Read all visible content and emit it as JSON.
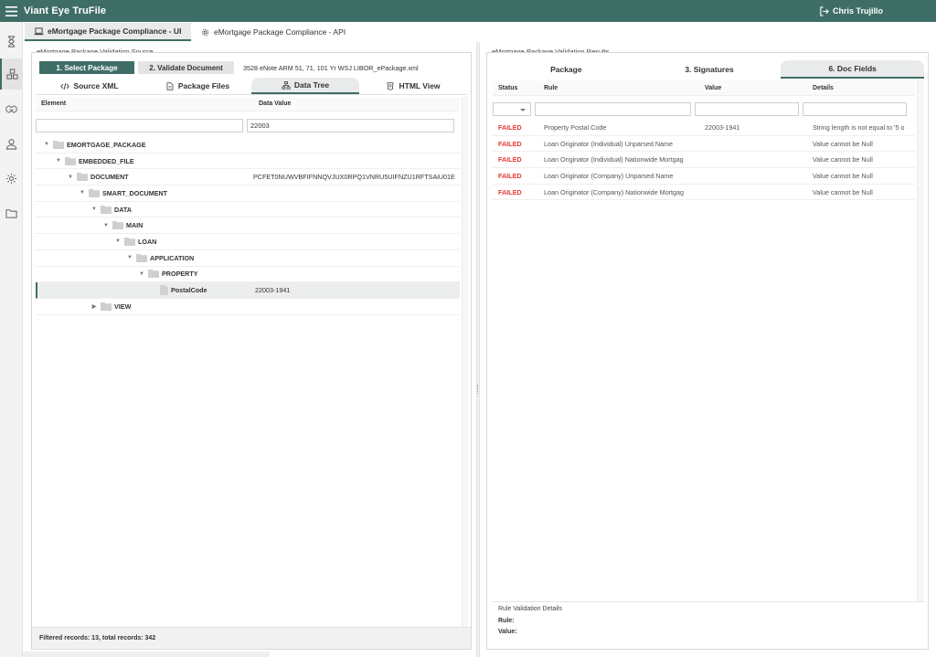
{
  "header": {
    "app_title": "Viant Eye TruFile",
    "user_name": "Chris Trujillo"
  },
  "leftrail": {
    "icons": [
      "hourglass-icon",
      "packages-icon",
      "handshake-icon",
      "user-icon",
      "gear-icon",
      "folder-icon"
    ]
  },
  "main_tabs": [
    {
      "label": "eMortgage Package Compliance - UI",
      "active": true
    },
    {
      "label": "eMortgage Package Compliance - API",
      "active": false
    }
  ],
  "source": {
    "legend": "eMortgage Package Validation Source",
    "step1": "1. Select Package",
    "step2": "2. Validate Document",
    "file_name": "3528 eNote ARM 51, 71, 101 Yr WSJ LIBOR_ePackage.xml",
    "tabs": [
      "Source XML",
      "Package Files",
      "Data Tree",
      "HTML View"
    ],
    "active_tab": "Data Tree",
    "columns": {
      "element": "Element",
      "value": "Data Value"
    },
    "filter": {
      "element": "",
      "value": "22003"
    },
    "tree": [
      {
        "name": "EMORTGAGE_PACKAGE",
        "value": ""
      },
      {
        "name": "EMBEDDED_FILE",
        "value": ""
      },
      {
        "name": "DOCUMENT",
        "value": "PCFET0NUWVBFIFNNQVJUX0RPQ1VNRU5UIFNZU1RFTSAiU01E"
      },
      {
        "name": "SMART_DOCUMENT",
        "value": ""
      },
      {
        "name": "DATA",
        "value": ""
      },
      {
        "name": "MAIN",
        "value": ""
      },
      {
        "name": "LOAN",
        "value": ""
      },
      {
        "name": "APPLICATION",
        "value": ""
      },
      {
        "name": "PROPERTY",
        "value": ""
      },
      {
        "name": "PostalCode",
        "value": "22003-1941"
      },
      {
        "name": "VIEW",
        "value": ""
      }
    ],
    "status": "Filtered records: 13, total records: 342"
  },
  "results": {
    "legend": "eMortgage Package Validation Results",
    "tabs": [
      "Package",
      "3. Signatures",
      "6. Doc Fields"
    ],
    "active_tab": "6. Doc Fields",
    "columns": {
      "status": "Status",
      "rule": "Rule",
      "value": "Value",
      "details": "Details"
    },
    "rows": [
      {
        "status": "FAILED",
        "rule": "Property Postal Code",
        "value": "22003-1941",
        "details": "String length is not equal to '5 o"
      },
      {
        "status": "FAILED",
        "rule": "Loan Originator (Individual) Unparsed Name",
        "value": "",
        "details": "Value cannot be Null"
      },
      {
        "status": "FAILED",
        "rule": "Loan Originator (Individual) Nationwide Mortgag",
        "value": "",
        "details": "Value cannot be Null"
      },
      {
        "status": "FAILED",
        "rule": "Loan Originator (Company) Unparsed Name",
        "value": "",
        "details": "Value cannot be Null"
      },
      {
        "status": "FAILED",
        "rule": "Loan Originator (Company) Nationwide Mortgag",
        "value": "",
        "details": "Value cannot be Null"
      }
    ],
    "rule_details": {
      "title": "Rule Validation Details",
      "rule_label": "Rule:",
      "value_label": "Value:"
    }
  }
}
